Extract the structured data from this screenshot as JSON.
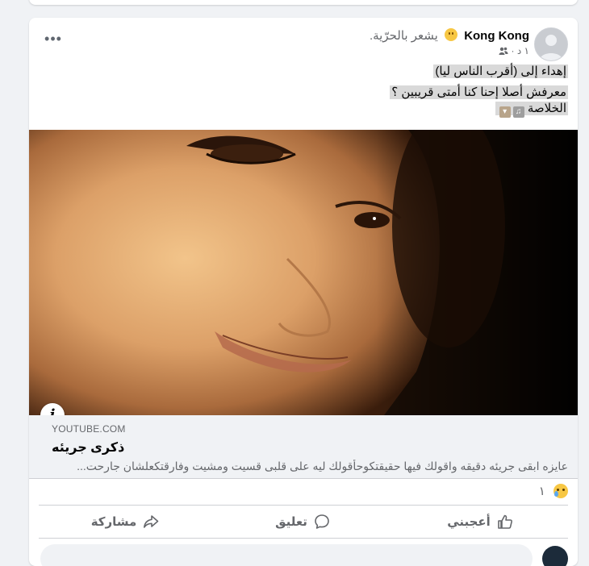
{
  "post": {
    "author": "Kong Kong",
    "feeling": "يشعر بالحرّية.",
    "timestamp": "١ د",
    "more_label": "•••",
    "text_line1": "إهداء إلى  (أقرب الناس ليا)",
    "text_line2": "معرفش أصلا إحنا كنا أمتى قريبين ؟",
    "text_line3": "الخلاصة",
    "emoji1": "🎧",
    "emoji2": "👎"
  },
  "link": {
    "info_label": "i",
    "domain": "YOUTUBE.COM",
    "title": "ذكرى جريئه",
    "description": "عايزه ابقى جريئه دقيقه واقولك فيها حقيقتكوحأقولك ليه على قلبى قسيت ومشيت وفارقتكعلشان جارحت..."
  },
  "reactions": {
    "count": "١"
  },
  "actions": {
    "like": "أعجبني",
    "comment": "تعليق",
    "share": "مشاركة"
  },
  "colors": {
    "accent": "#1877f2",
    "secondary_text": "#65676b",
    "background": "#f0f2f5"
  }
}
